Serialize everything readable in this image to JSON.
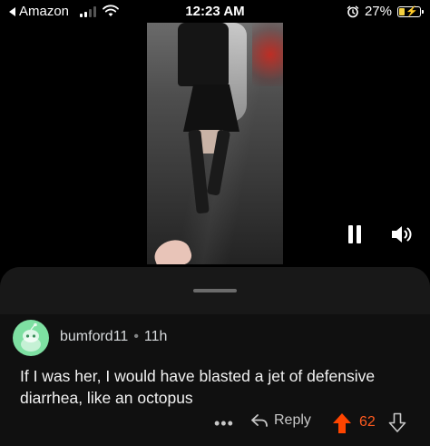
{
  "status_bar": {
    "back_label": "Amazon",
    "time": "12:23 AM",
    "battery_percent": "27%",
    "battery_level": 0.27,
    "battery_color": "#f4d03f",
    "icons": [
      "back-arrow-icon",
      "cellular-signal-icon",
      "wifi-icon",
      "alarm-icon",
      "battery-charging-icon"
    ]
  },
  "video": {
    "controls": [
      "pause-icon",
      "volume-icon"
    ]
  },
  "comment": {
    "author": "bumford11",
    "separator": "•",
    "age": "11h",
    "body": "If I was her, I would have blasted a jet of defensive diarrhea, like an octopus",
    "avatar_color": "#7ee0a2",
    "actions": {
      "more_label": "•••",
      "reply_label": "Reply",
      "score": "62",
      "upvoted": true,
      "upvote_color": "#ff4500"
    }
  }
}
